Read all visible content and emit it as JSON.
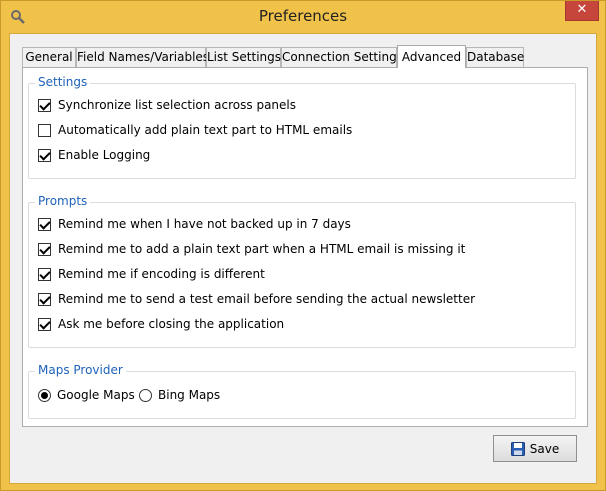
{
  "window": {
    "title": "Preferences",
    "close_glyph": "✕"
  },
  "tabs": [
    {
      "label": "General",
      "active": false
    },
    {
      "label": "Field Names/Variables",
      "active": false
    },
    {
      "label": "List Settings",
      "active": false
    },
    {
      "label": "Connection Settings",
      "active": false
    },
    {
      "label": "Advanced",
      "active": true
    },
    {
      "label": "Database",
      "active": false
    }
  ],
  "settings": {
    "title": "Settings",
    "items": [
      {
        "label": "Synchronize list selection across panels",
        "checked": true
      },
      {
        "label": "Automatically add plain text part to HTML emails",
        "checked": false
      },
      {
        "label": "Enable Logging",
        "checked": true
      }
    ]
  },
  "prompts": {
    "title": "Prompts",
    "items": [
      {
        "label": "Remind me when I have not backed up in 7 days",
        "checked": true
      },
      {
        "label": "Remind me to add a plain text part when a HTML email is missing it",
        "checked": true
      },
      {
        "label": "Remind me if encoding is different",
        "checked": true
      },
      {
        "label": "Remind me to send a test email before sending the actual newsletter",
        "checked": true
      },
      {
        "label": "Ask me before closing the application",
        "checked": true
      }
    ]
  },
  "maps": {
    "title": "Maps Provider",
    "options": [
      {
        "label": "Google Maps",
        "selected": true
      },
      {
        "label": "Bing Maps",
        "selected": false
      }
    ]
  },
  "footer": {
    "save_label": "Save"
  },
  "icons": {
    "app": "search-gear-icon",
    "save": "floppy-disk-icon"
  },
  "colors": {
    "frame": "#f0c24a",
    "group_title": "#1f62b8",
    "close": "#c7463b"
  }
}
